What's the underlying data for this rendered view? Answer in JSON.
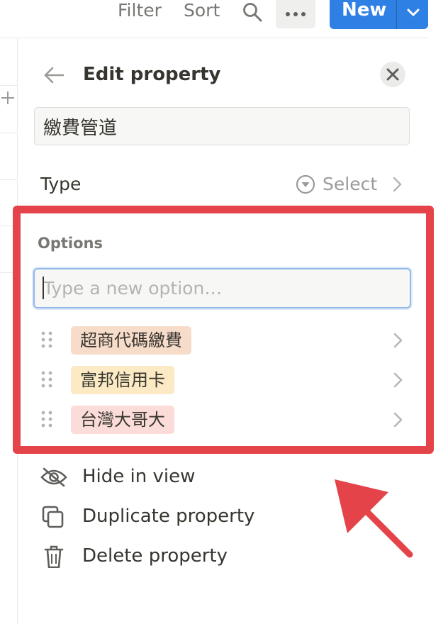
{
  "toolbar": {
    "filter_label": "Filter",
    "sort_label": "Sort",
    "new_label": "New",
    "brand_color": "#2f80e4"
  },
  "panel": {
    "title": "Edit property",
    "property_name": "繳費管道",
    "type_label": "Type",
    "type_value": "Select"
  },
  "options": {
    "label": "Options",
    "input_placeholder": "Type a new option…",
    "items": [
      {
        "label": "超商代碼繳費",
        "color": "#f7dcca"
      },
      {
        "label": "富邦信用卡",
        "color": "#fbeac4"
      },
      {
        "label": "台灣大哥大",
        "color": "#fbdcd9"
      }
    ]
  },
  "actions": {
    "hide_label": "Hide in view",
    "duplicate_label": "Duplicate property",
    "delete_label": "Delete property"
  },
  "annotation": {
    "highlight_color": "#e5434a"
  }
}
